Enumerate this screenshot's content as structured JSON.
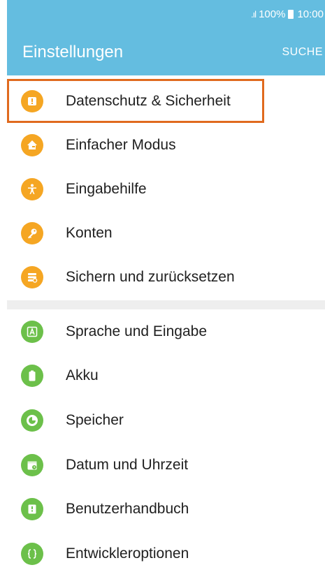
{
  "status": {
    "signal": ".ıl",
    "battery": "100%",
    "time": "10:00"
  },
  "header": {
    "title": "Einstellungen",
    "search_label": "SUCHE"
  },
  "section1": [
    {
      "label": "Datenschutz & Sicherheit",
      "icon": "shield-lock-icon",
      "color": "#f5a623"
    },
    {
      "label": "Einfacher Modus",
      "icon": "home-icon",
      "color": "#f5a623"
    },
    {
      "label": "Eingabehilfe",
      "icon": "accessibility-person-icon",
      "color": "#f5a623"
    },
    {
      "label": "Konten",
      "icon": "key-icon",
      "color": "#f5a623"
    },
    {
      "label": "Sichern und zurücksetzen",
      "icon": "backup-restore-icon",
      "color": "#f5a623"
    }
  ],
  "section2": [
    {
      "label": "Sprache und Eingabe",
      "icon": "language-a-icon",
      "color": "#6cc04a"
    },
    {
      "label": "Akku",
      "icon": "battery-icon",
      "color": "#6cc04a"
    },
    {
      "label": "Speicher",
      "icon": "storage-pie-icon",
      "color": "#6cc04a"
    },
    {
      "label": "Datum und Uhrzeit",
      "icon": "calendar-clock-icon",
      "color": "#6cc04a"
    },
    {
      "label": "Benutzerhandbuch",
      "icon": "user-manual-icon",
      "color": "#6cc04a"
    },
    {
      "label": "Entwickleroptionen",
      "icon": "developer-braces-icon",
      "color": "#6cc04a"
    }
  ],
  "highlight_color": "#e06a1e",
  "accent": "#64bde0"
}
